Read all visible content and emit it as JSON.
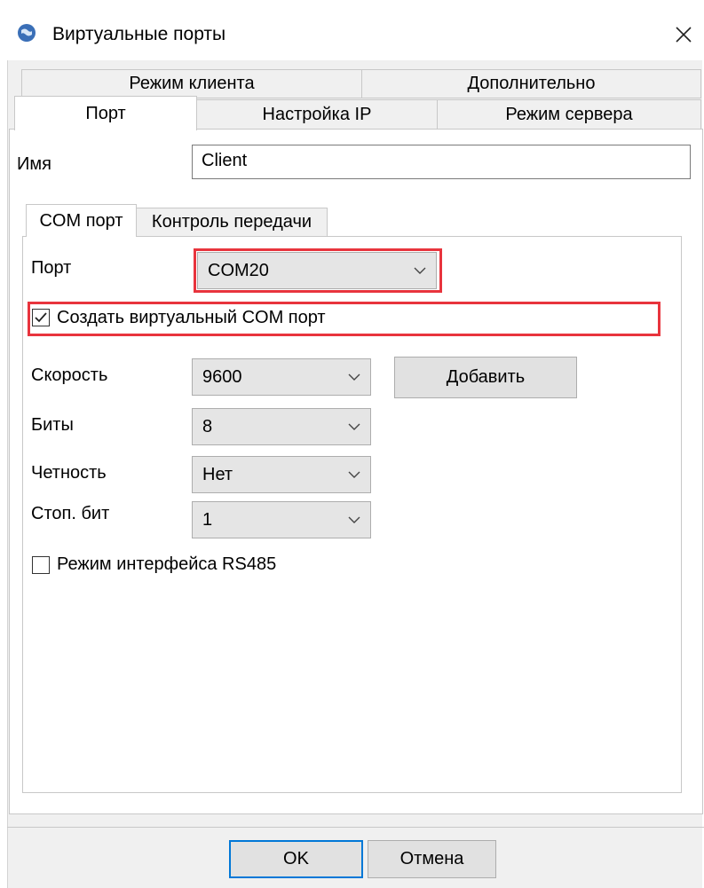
{
  "window": {
    "title": "Виртуальные порты",
    "icon": "app-globe-icon",
    "close_icon": "close-icon"
  },
  "top_tabs": {
    "row1": [
      "Режим клиента",
      "Дополнительно"
    ],
    "row2": [
      "Порт",
      "Настройка IP",
      "Режим сервера"
    ],
    "active": "Порт"
  },
  "name_field": {
    "label": "Имя",
    "value": "Client"
  },
  "inner_tabs": {
    "items": [
      "COM порт",
      "Контроль передачи"
    ],
    "active": "COM порт"
  },
  "port": {
    "label": "Порт",
    "value": "COM20"
  },
  "create_virtual": {
    "label": "Создать виртуальный COM порт",
    "checked": true
  },
  "speed": {
    "label": "Скорость",
    "value": "9600",
    "add_button": "Добавить"
  },
  "bits": {
    "label": "Биты",
    "value": "8"
  },
  "parity": {
    "label": "Четность",
    "value": "Нет"
  },
  "stop_bits": {
    "label": "Стоп. бит",
    "value": "1"
  },
  "rs485": {
    "label": "Режим интерфейса RS485",
    "checked": false
  },
  "footer": {
    "ok": "OK",
    "cancel": "Отмена"
  },
  "colors": {
    "highlight": "#e8343d",
    "default_button_border": "#0078d7",
    "dialog_bg": "#f0f0f0"
  }
}
